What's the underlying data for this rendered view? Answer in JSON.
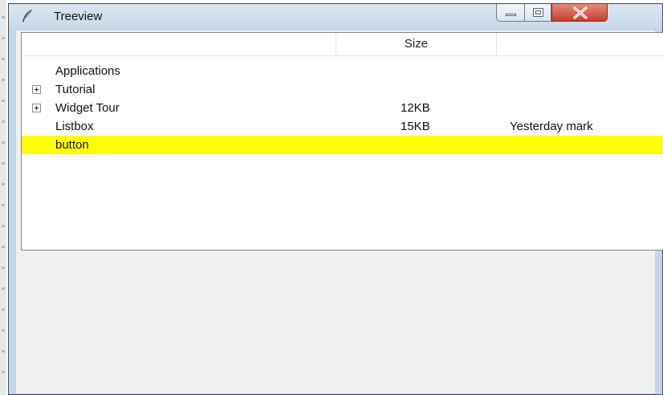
{
  "window": {
    "title": "Treeview"
  },
  "caption_buttons": {
    "minimize": "minimize",
    "maximize": "maximize",
    "close": "close"
  },
  "tree": {
    "columns": [
      {
        "id": "tree",
        "label": ""
      },
      {
        "id": "size",
        "label": "Size"
      },
      {
        "id": "modified",
        "label": ""
      }
    ],
    "rows": [
      {
        "name": "Applications",
        "size": "",
        "modified": "",
        "expandable": false,
        "selected": false
      },
      {
        "name": "Tutorial",
        "size": "",
        "modified": "",
        "expandable": true,
        "selected": false
      },
      {
        "name": "Widget Tour",
        "size": "12KB",
        "modified": "",
        "expandable": true,
        "selected": false
      },
      {
        "name": "Listbox",
        "size": "15KB",
        "modified": "Yesterday mark",
        "expandable": false,
        "selected": false
      },
      {
        "name": "button",
        "size": "",
        "modified": "",
        "expandable": false,
        "selected": true
      }
    ],
    "selection_color": "#ffff00"
  }
}
